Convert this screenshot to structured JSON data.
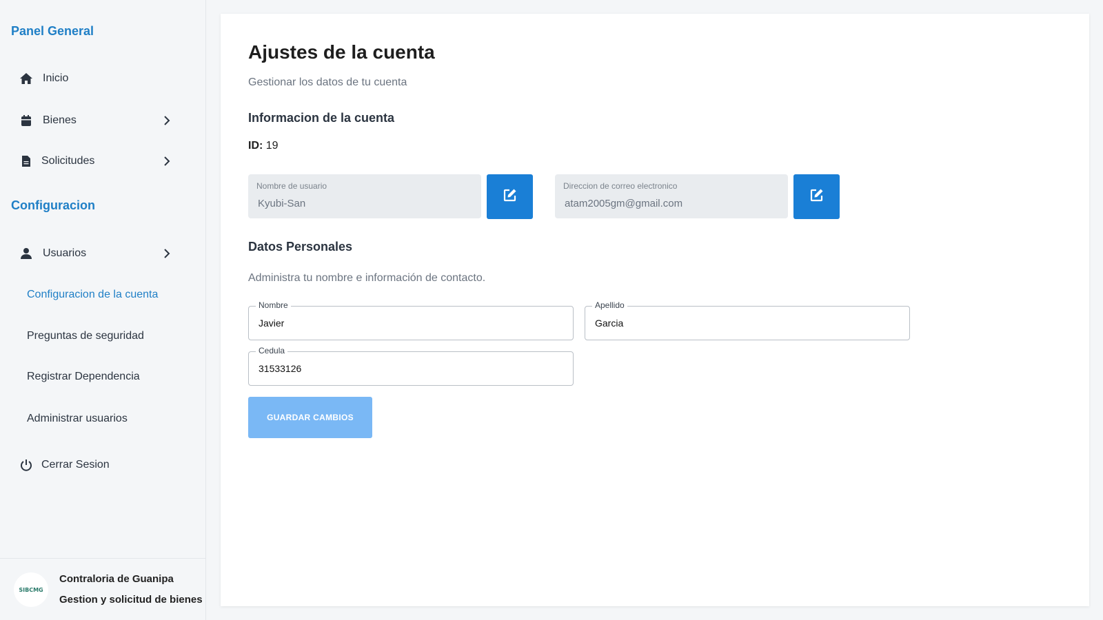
{
  "sidebar": {
    "section_general": "Panel General",
    "section_config": "Configuracion",
    "items": {
      "inicio": "Inicio",
      "bienes": "Bienes",
      "solicitudes": "Solicitudes",
      "usuarios": "Usuarios",
      "cerrar_sesion": "Cerrar Sesion"
    },
    "subitems": {
      "config_cuenta": "Configuracion de la cuenta",
      "preguntas": "Preguntas de seguridad",
      "registrar_dep": "Registrar Dependencia",
      "admin_usuarios": "Administrar usuarios"
    },
    "footer": {
      "logo_text": "SIBCMG",
      "org_name": "Contraloria de Guanipa",
      "org_subtitle": "Gestion y solicitud de bienes"
    }
  },
  "main": {
    "title": "Ajustes de la cuenta",
    "subtitle": "Gestionar los datos de tu cuenta",
    "account_section": "Informacion de la cuenta",
    "id_label": "ID:",
    "id_value": "19",
    "username_label": "Nombre de usuario",
    "username_value": "Kyubi-San",
    "email_label": "Direccion de correo electronico",
    "email_value": "atam2005gm@gmail.com",
    "personal_section": "Datos Personales",
    "personal_desc": "Administra tu nombre e información de contacto.",
    "nombre_label": "Nombre",
    "nombre_value": "Javier",
    "apellido_label": "Apellido",
    "apellido_value": "Garcia",
    "cedula_label": "Cedula",
    "cedula_value": "31533126",
    "save_label": "GUARDAR CAMBIOS"
  },
  "colors": {
    "accent": "#1f7fc6",
    "edit_button": "#1a7fd6",
    "save_button_disabled": "#7ab8f5"
  },
  "icons": {
    "inicio": "home-icon",
    "bienes": "calendar-icon",
    "solicitudes": "document-icon",
    "usuarios": "user-icon",
    "cerrar_sesion": "power-icon",
    "edit": "edit-icon",
    "chevron": "chevron-right-icon"
  }
}
